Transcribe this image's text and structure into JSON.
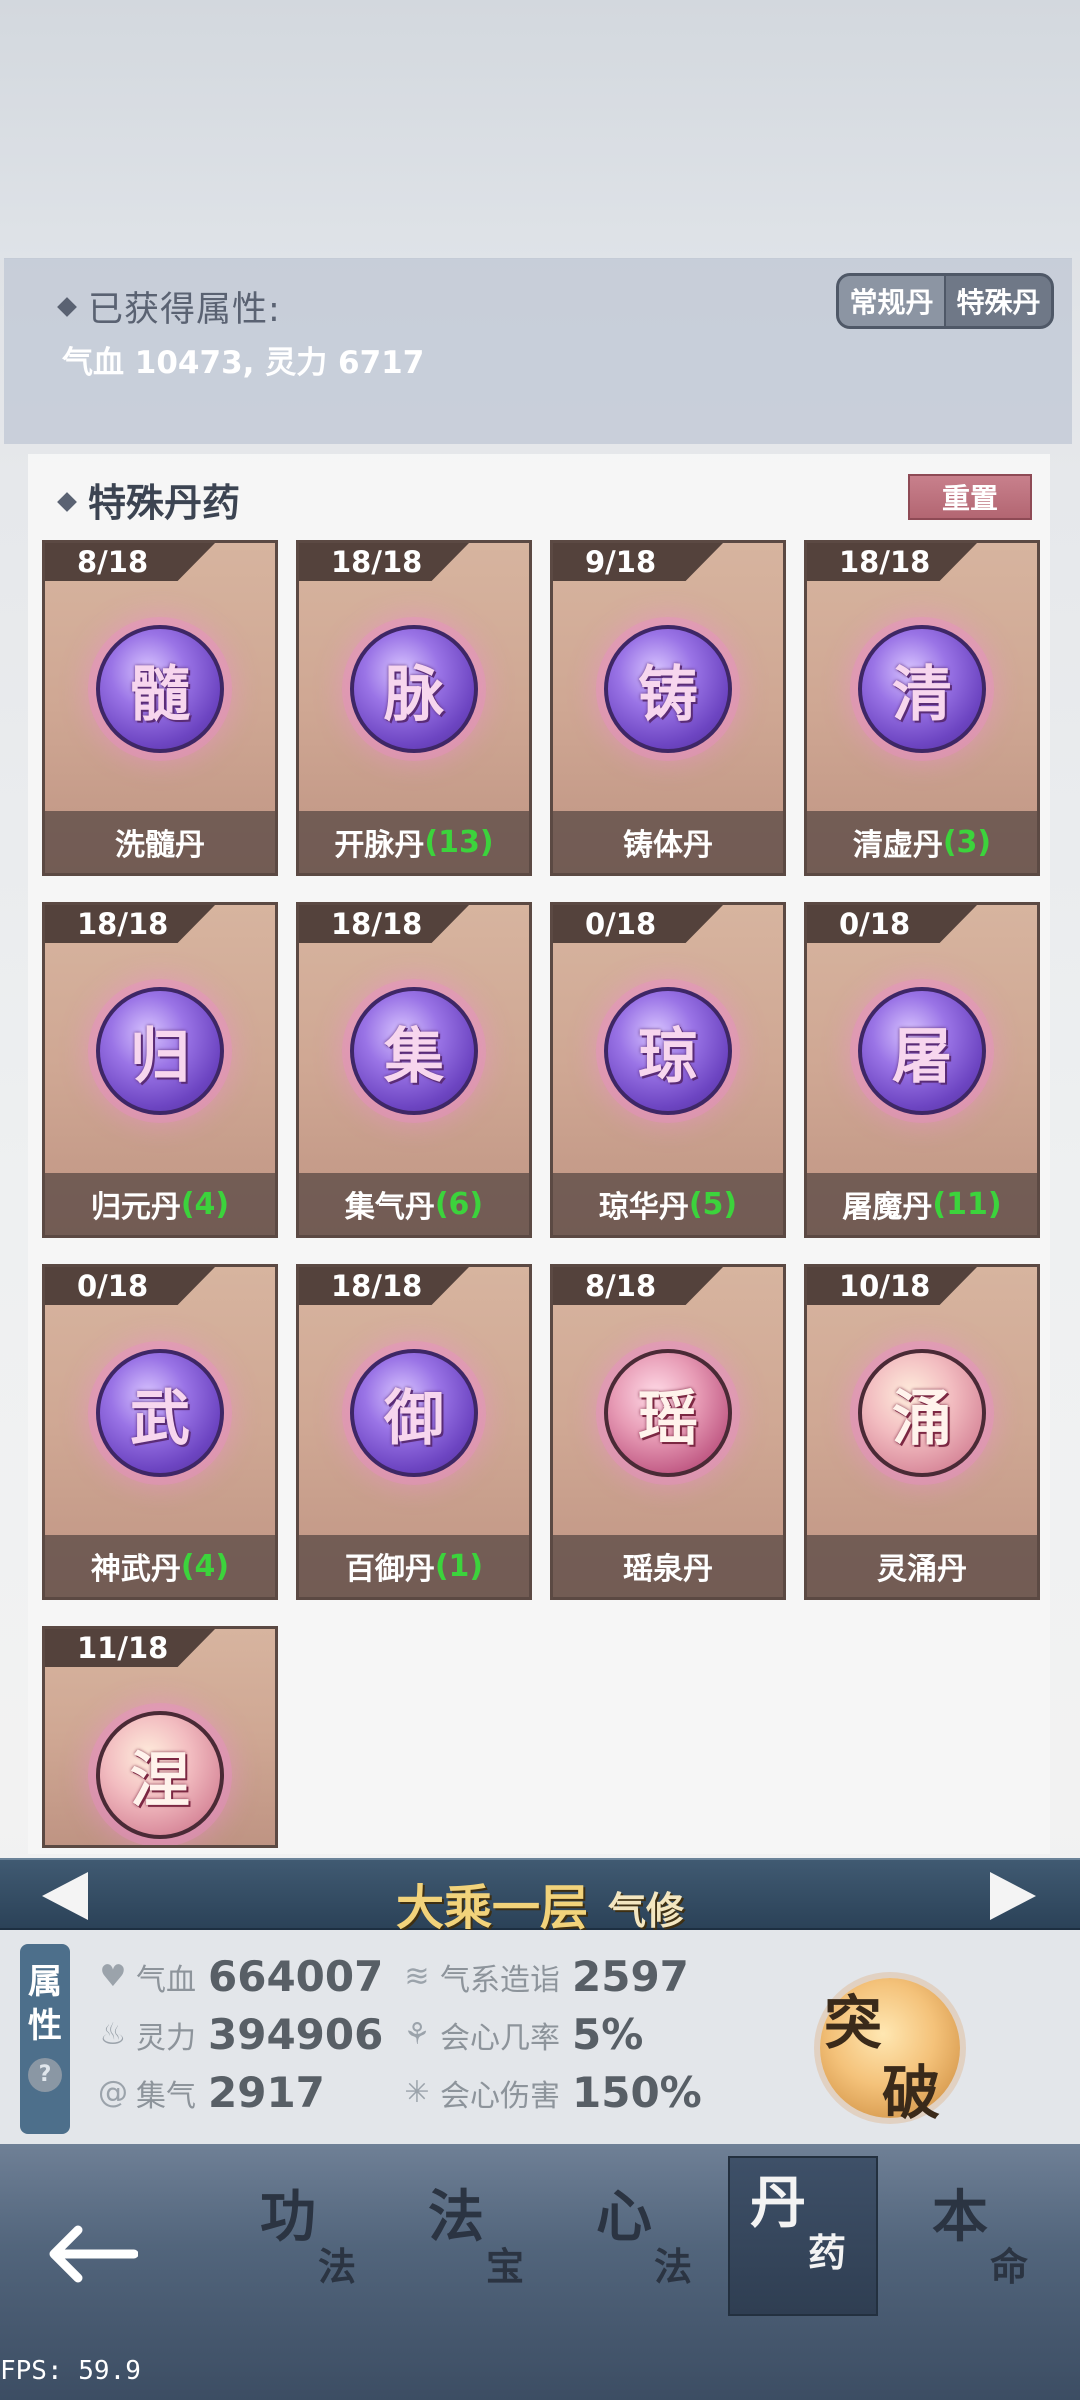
{
  "attributes": {
    "title": "已获得属性:",
    "value": "气血 10473, 灵力 6717",
    "segment": [
      "常规丹",
      "特殊丹"
    ]
  },
  "panel": {
    "title": "特殊丹药",
    "reset_label": "重置"
  },
  "pills": [
    {
      "count": "8/18",
      "char": "髓",
      "name": "洗髓丹",
      "qty": "",
      "style": "purple"
    },
    {
      "count": "18/18",
      "char": "脉",
      "name": "开脉丹",
      "qty": "(13)",
      "style": "purple"
    },
    {
      "count": "9/18",
      "char": "铸",
      "name": "铸体丹",
      "qty": "",
      "style": "purple"
    },
    {
      "count": "18/18",
      "char": "清",
      "name": "清虚丹",
      "qty": "(3)",
      "style": "purple"
    },
    {
      "count": "18/18",
      "char": "归",
      "name": "归元丹",
      "qty": "(4)",
      "style": "purple"
    },
    {
      "count": "18/18",
      "char": "集",
      "name": "集气丹",
      "qty": "(6)",
      "style": "purple"
    },
    {
      "count": "0/18",
      "char": "琼",
      "name": "琼华丹",
      "qty": "(5)",
      "style": "purple"
    },
    {
      "count": "0/18",
      "char": "屠",
      "name": "屠魔丹",
      "qty": "(11)",
      "style": "purple"
    },
    {
      "count": "0/18",
      "char": "武",
      "name": "神武丹",
      "qty": "(4)",
      "style": "purple"
    },
    {
      "count": "18/18",
      "char": "御",
      "name": "百御丹",
      "qty": "(1)",
      "style": "purple"
    },
    {
      "count": "8/18",
      "char": "瑶",
      "name": "瑶泉丹",
      "qty": "",
      "style": "pink"
    },
    {
      "count": "10/18",
      "char": "涌",
      "name": "灵涌丹",
      "qty": "",
      "style": "gold"
    },
    {
      "count": "11/18",
      "char": "涅",
      "name": "",
      "qty": "",
      "style": "gold"
    }
  ],
  "realm": {
    "title": "大乘一层",
    "sub": "气修"
  },
  "stats": {
    "tab_label": "属性",
    "items": [
      {
        "label": "气血",
        "value": "664007",
        "icon": "heart-icon"
      },
      {
        "label": "灵力",
        "value": "394906",
        "icon": "flame-icon"
      },
      {
        "label": "集气",
        "value": "2917",
        "icon": "swirl-icon"
      },
      {
        "label": "气系造诣",
        "value": "2597",
        "icon": "wind-icon"
      },
      {
        "label": "会心几率",
        "value": "5%",
        "icon": "crit-rate-icon"
      },
      {
        "label": "会心伤害",
        "value": "150%",
        "icon": "crit-damage-icon"
      }
    ],
    "breakthrough": [
      "突",
      "破"
    ]
  },
  "nav": [
    {
      "main": "功",
      "sub": "法"
    },
    {
      "main": "法",
      "sub": "宝"
    },
    {
      "main": "心",
      "sub": "法"
    },
    {
      "main": "丹",
      "sub": "药"
    },
    {
      "main": "本",
      "sub": "命"
    }
  ],
  "fps": "FPS: 59.9"
}
